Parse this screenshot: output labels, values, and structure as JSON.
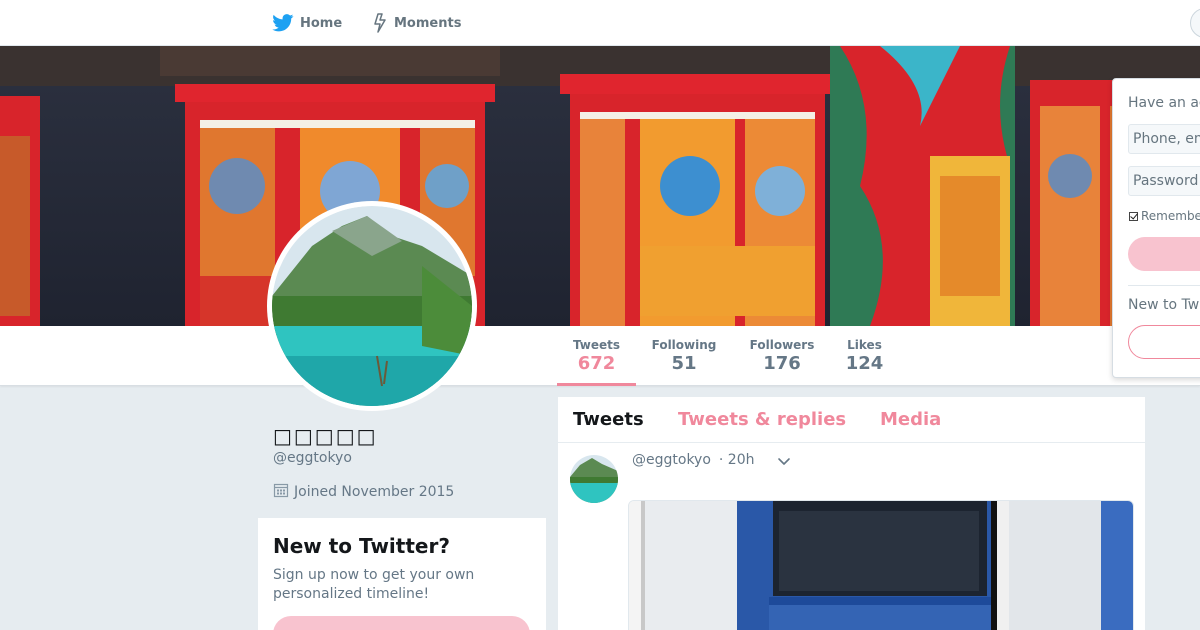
{
  "nav": {
    "home_label": "Home",
    "moments_label": "Moments"
  },
  "profile": {
    "display_name": "□□□□□",
    "screen_name": "@eggtokyo",
    "joined": "Joined November 2015"
  },
  "stats": [
    {
      "label": "Tweets",
      "value": "672"
    },
    {
      "label": "Following",
      "value": "51"
    },
    {
      "label": "Followers",
      "value": "176"
    },
    {
      "label": "Likes",
      "value": "124"
    }
  ],
  "signup_card": {
    "title": "New to Twitter?",
    "text": "Sign up now to get your own personalized timeline!"
  },
  "timeline": {
    "tabs": [
      "Tweets",
      "Tweets & replies",
      "Media"
    ],
    "tweet": {
      "screen_name": "@eggtokyo",
      "time": "· 20h"
    }
  },
  "login": {
    "title": "Have an account?",
    "phone_placeholder": "Phone, email or username",
    "password_placeholder": "Password",
    "remember": "Remember me",
    "new_prompt": "New to Twitter?"
  },
  "colors": {
    "accent": "#f0889c",
    "accent_light": "#f8c3cf",
    "background": "#e6ecf0",
    "twitter_blue": "#1da1f2"
  },
  "icons": [
    "twitter-bird-icon",
    "lightning-icon",
    "calendar-icon",
    "chevron-down-icon"
  ]
}
